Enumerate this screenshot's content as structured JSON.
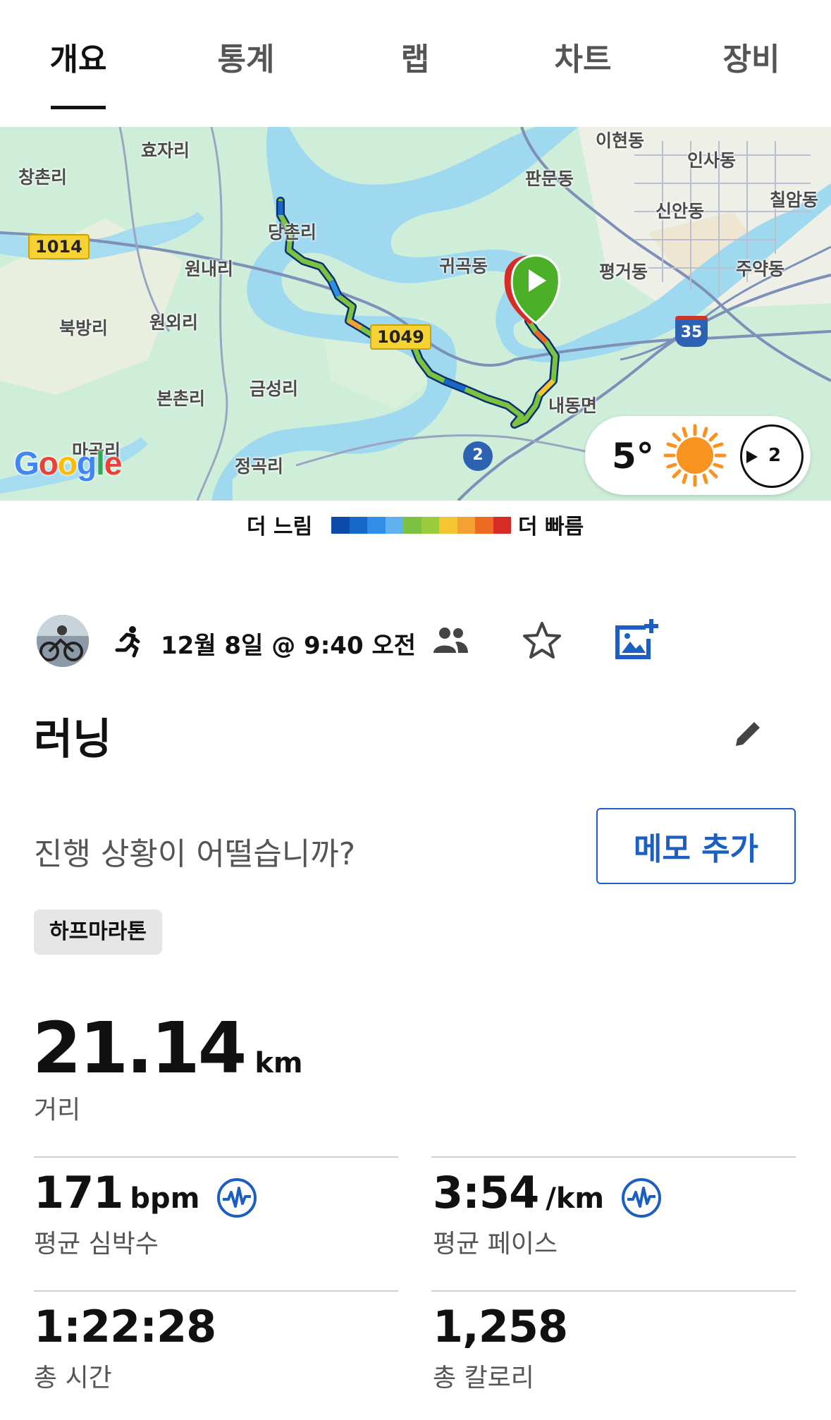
{
  "tabs": [
    {
      "label": "개요",
      "active": true
    },
    {
      "label": "통계",
      "active": false
    },
    {
      "label": "랩",
      "active": false
    },
    {
      "label": "차트",
      "active": false
    },
    {
      "label": "장비",
      "active": false
    }
  ],
  "map": {
    "places": [
      "이현동",
      "인사동",
      "칠암동",
      "효자리",
      "창촌리",
      "판문동",
      "신안동",
      "당촌리",
      "원내리",
      "귀곡동",
      "평거동",
      "주약동",
      "북방리",
      "원외리",
      "본촌리",
      "금성리",
      "내동면",
      "마곡리",
      "정곡리"
    ],
    "roads": [
      "1014",
      "1049",
      "35",
      "2"
    ],
    "provider": "Google",
    "weather": {
      "temperature": "5°",
      "icon": "sun-icon",
      "wind_speed": "2"
    }
  },
  "legend": {
    "slow_label": "더 느림",
    "fast_label": "더 빠름",
    "colors": [
      "#0a4aa8",
      "#1668c9",
      "#2f8fe6",
      "#5fb2ee",
      "#7cc242",
      "#9acb3c",
      "#f2c531",
      "#f5a033",
      "#ec6b22",
      "#d92b25"
    ]
  },
  "activity": {
    "date": "12월 8일 @ 9:40 오전",
    "title": "러닝",
    "prompt": "진행 상황이 어떨습니까?",
    "memo_button": "메모 추가",
    "tag": "하프마라톤"
  },
  "stats": {
    "distance": {
      "value": "21.14",
      "unit": "km",
      "label": "거리"
    },
    "avg_heart_rate": {
      "value": "171",
      "unit": "bpm",
      "label": "평균 심박수"
    },
    "avg_pace": {
      "value": "3:54",
      "unit": "/km",
      "label": "평균 페이스"
    },
    "total_time": {
      "value": "1:22:28",
      "label": "총 시간"
    },
    "total_calories": {
      "value": "1,258",
      "label": "총 칼로리"
    }
  },
  "colors": {
    "accent": "#1a5fc1",
    "start_marker": "#4caf28"
  }
}
